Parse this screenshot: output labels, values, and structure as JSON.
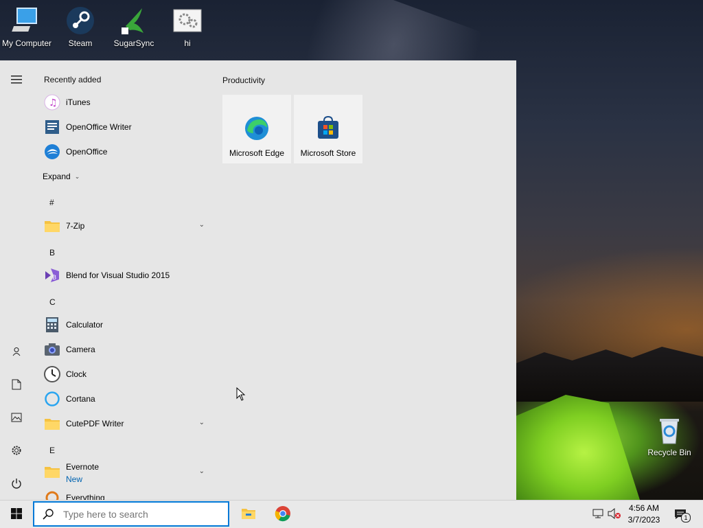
{
  "desktop": {
    "icons": [
      {
        "label": "My Computer",
        "icon": "computer-icon"
      },
      {
        "label": "Steam",
        "icon": "steam-icon"
      },
      {
        "label": "SugarSync",
        "icon": "sugarsync-icon"
      },
      {
        "label": "hi",
        "icon": "gears-window-icon"
      }
    ],
    "recycle_bin": {
      "label": "Recycle Bin",
      "icon": "recycle-bin-icon"
    }
  },
  "start_menu": {
    "rail": [
      "hamburger-menu-icon",
      "user-icon",
      "documents-icon",
      "pictures-icon",
      "settings-gear-icon",
      "power-icon"
    ],
    "recently_added": {
      "heading": "Recently added",
      "items": [
        {
          "label": "iTunes",
          "icon": "itunes-icon"
        },
        {
          "label": "OpenOffice Writer",
          "icon": "openoffice-writer-icon"
        },
        {
          "label": "OpenOffice",
          "icon": "openoffice-icon"
        }
      ],
      "expand_label": "Expand"
    },
    "groups": [
      {
        "letter": "#",
        "apps": [
          {
            "label": "7-Zip",
            "icon": "folder-icon",
            "expandable": true
          }
        ]
      },
      {
        "letter": "B",
        "apps": [
          {
            "label": "Blend for Visual Studio 2015",
            "icon": "blend-icon"
          }
        ]
      },
      {
        "letter": "C",
        "apps": [
          {
            "label": "Calculator",
            "icon": "calculator-icon"
          },
          {
            "label": "Camera",
            "icon": "camera-icon"
          },
          {
            "label": "Clock",
            "icon": "clock-icon"
          },
          {
            "label": "Cortana",
            "icon": "cortana-icon"
          },
          {
            "label": "CutePDF Writer",
            "icon": "folder-icon",
            "expandable": true
          }
        ]
      },
      {
        "letter": "E",
        "apps": [
          {
            "label": "Evernote",
            "icon": "folder-icon",
            "expandable": true,
            "badge": "New"
          },
          {
            "label": "Everything",
            "icon": "everything-icon"
          }
        ]
      }
    ],
    "tiles": {
      "heading": "Productivity",
      "items": [
        {
          "label": "Microsoft Edge",
          "icon": "edge-icon"
        },
        {
          "label": "Microsoft Store",
          "icon": "store-icon"
        }
      ]
    }
  },
  "taskbar": {
    "search_placeholder": "Type here to search",
    "pinned": [
      "file-explorer-icon",
      "chrome-icon"
    ],
    "tray": [
      "network-icon",
      "volume-muted-icon"
    ],
    "time": "4:56 AM",
    "date": "3/7/2023",
    "notification_count": "1"
  },
  "colors": {
    "accent": "#0078d7",
    "start_bg": "#e6e6e6",
    "taskbar_bg": "#e9e9e9"
  }
}
